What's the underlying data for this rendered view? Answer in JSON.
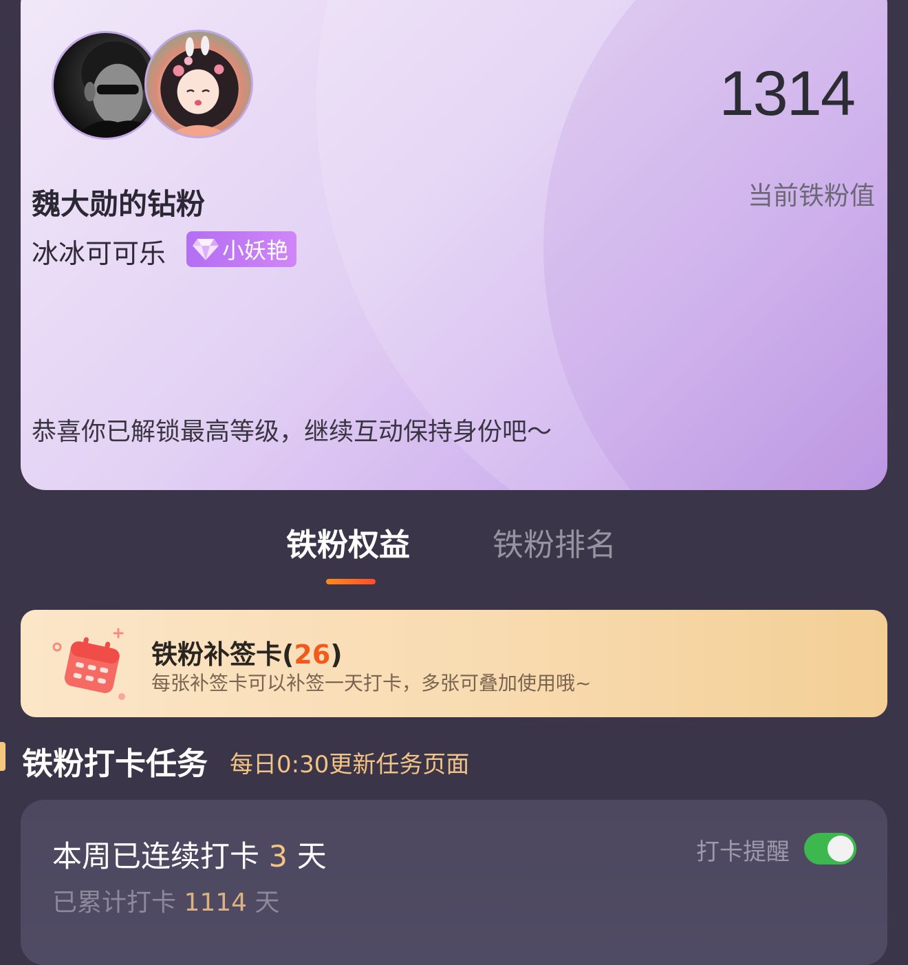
{
  "fan_card": {
    "group_name": "魏大勋的钻粉",
    "user_name": "冰冰可可乐",
    "level_badge": "小妖艳",
    "score": "1314",
    "score_label": "当前铁粉值",
    "congrats": "恭喜你已解锁最高等级，继续互动保持身份吧～",
    "icons": [
      "idol-avatar",
      "user-avatar",
      "diamond-icon"
    ]
  },
  "tabs": {
    "benefits": "铁粉权益",
    "ranking": "铁粉排名",
    "active": "benefits"
  },
  "makeup_card": {
    "title": "铁粉补签卡",
    "count": "26",
    "description": "每张补签卡可以补签一天打卡，多张可叠加使用哦~",
    "icon": "calendar-icon"
  },
  "checkin_section": {
    "title": "铁粉打卡任务",
    "subtitle": "每日0:30更新任务页面"
  },
  "checkin_card": {
    "streak_prefix": "本周已连续打卡",
    "streak_days": "3",
    "streak_suffix": "天",
    "total_prefix": "已累计打卡",
    "total_days": "1114",
    "total_suffix": "天",
    "reminder_label": "打卡提醒",
    "reminder_enabled": true
  },
  "colors": {
    "page_background": "#3a3548",
    "accent_orange": "#f25a1c",
    "accent_gold": "#f4c486",
    "toggle_on": "#3cb84f",
    "badge_purple": "#b36ef3"
  }
}
